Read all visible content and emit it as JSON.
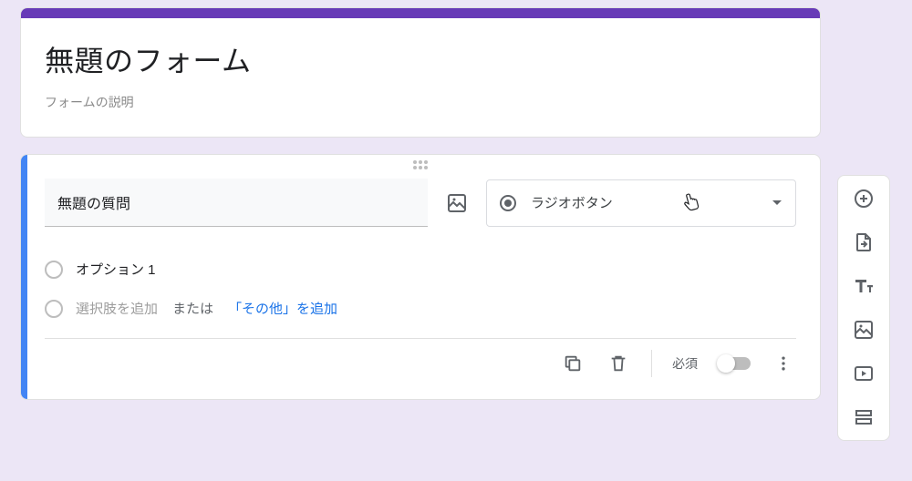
{
  "header": {
    "title": "無題のフォーム",
    "description": "フォームの説明"
  },
  "question": {
    "title": "無題の質問",
    "type_label": "ラジオボタン",
    "option1": "オプション 1",
    "add_option_placeholder": "選択肢を追加",
    "or_text": "または",
    "add_other_link": "「その他」を追加",
    "required_label": "必須",
    "required_state": false
  },
  "colors": {
    "accent": "#673ab7",
    "active": "#4285f4",
    "link": "#1a73e8"
  },
  "toolbar_icons": [
    "add-question",
    "import-questions",
    "add-title",
    "add-image",
    "add-video",
    "add-section"
  ]
}
